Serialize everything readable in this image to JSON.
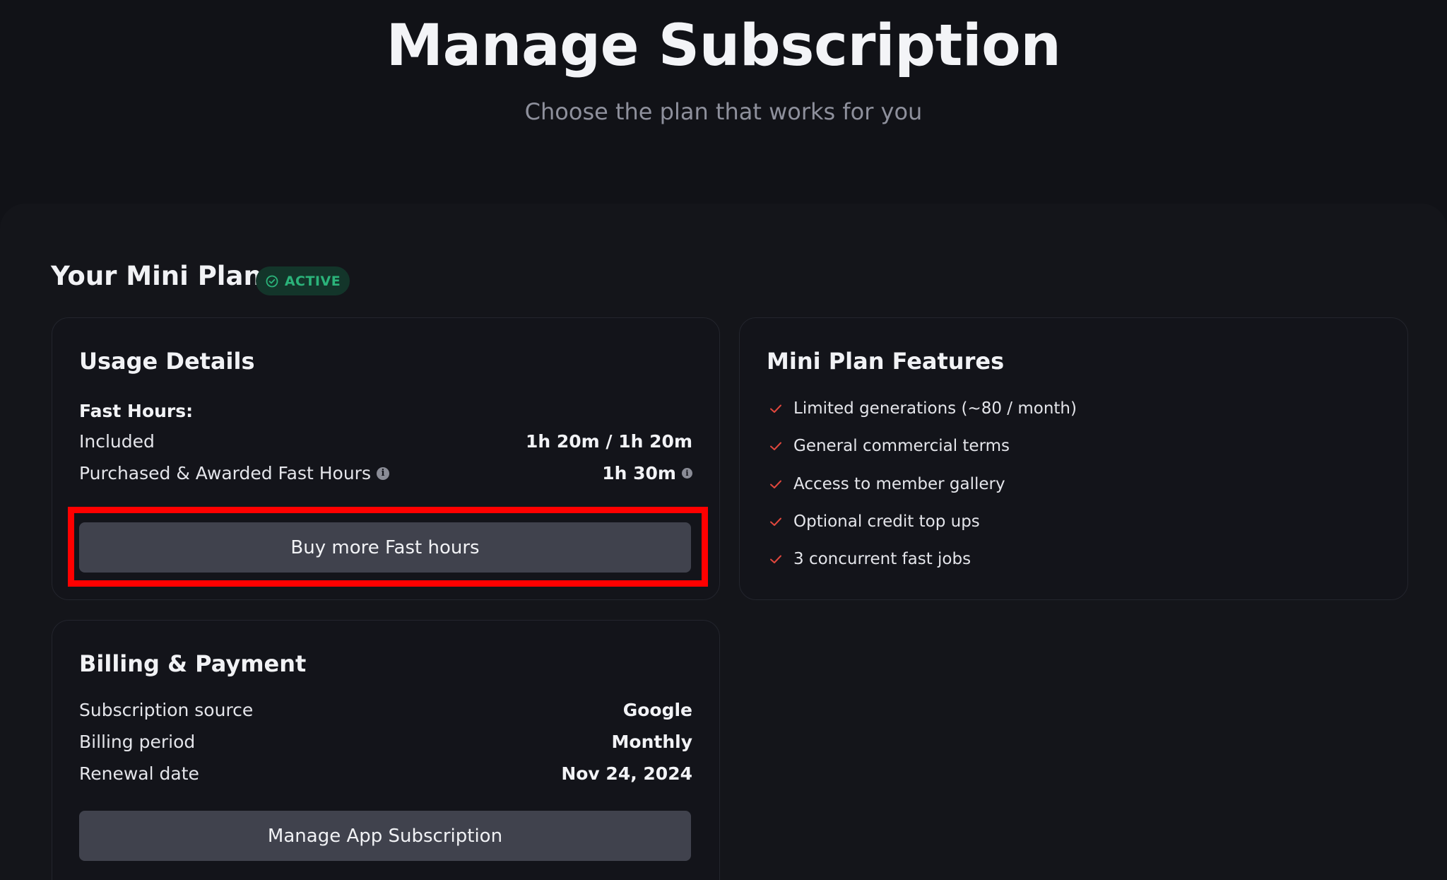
{
  "header": {
    "title": "Manage Subscription",
    "subtitle": "Choose the plan that works for you"
  },
  "plan": {
    "title": "Your Mini Plan",
    "status_badge": "ACTIVE",
    "status_color": "#2bb37a"
  },
  "usage": {
    "title": "Usage Details",
    "fast_hours_label": "Fast Hours:",
    "included_label": "Included",
    "included_value": "1h 20m / 1h 20m",
    "purchased_label": "Purchased & Awarded Fast Hours",
    "purchased_value": "1h 30m",
    "info_icon": "info-icon",
    "buy_button": "Buy more Fast hours"
  },
  "features": {
    "title": "Mini Plan Features",
    "check_color": "#e0473d",
    "items": [
      "Limited generations (~80 / month)",
      "General commercial terms",
      "Access to member gallery",
      "Optional credit top ups",
      "3 concurrent fast jobs"
    ]
  },
  "billing": {
    "title": "Billing & Payment",
    "source_label": "Subscription source",
    "source_value": "Google",
    "period_label": "Billing period",
    "period_value": "Monthly",
    "renewal_label": "Renewal date",
    "renewal_value": "Nov 24, 2024",
    "manage_button": "Manage App Subscription"
  },
  "highlight_color": "#ff0000"
}
